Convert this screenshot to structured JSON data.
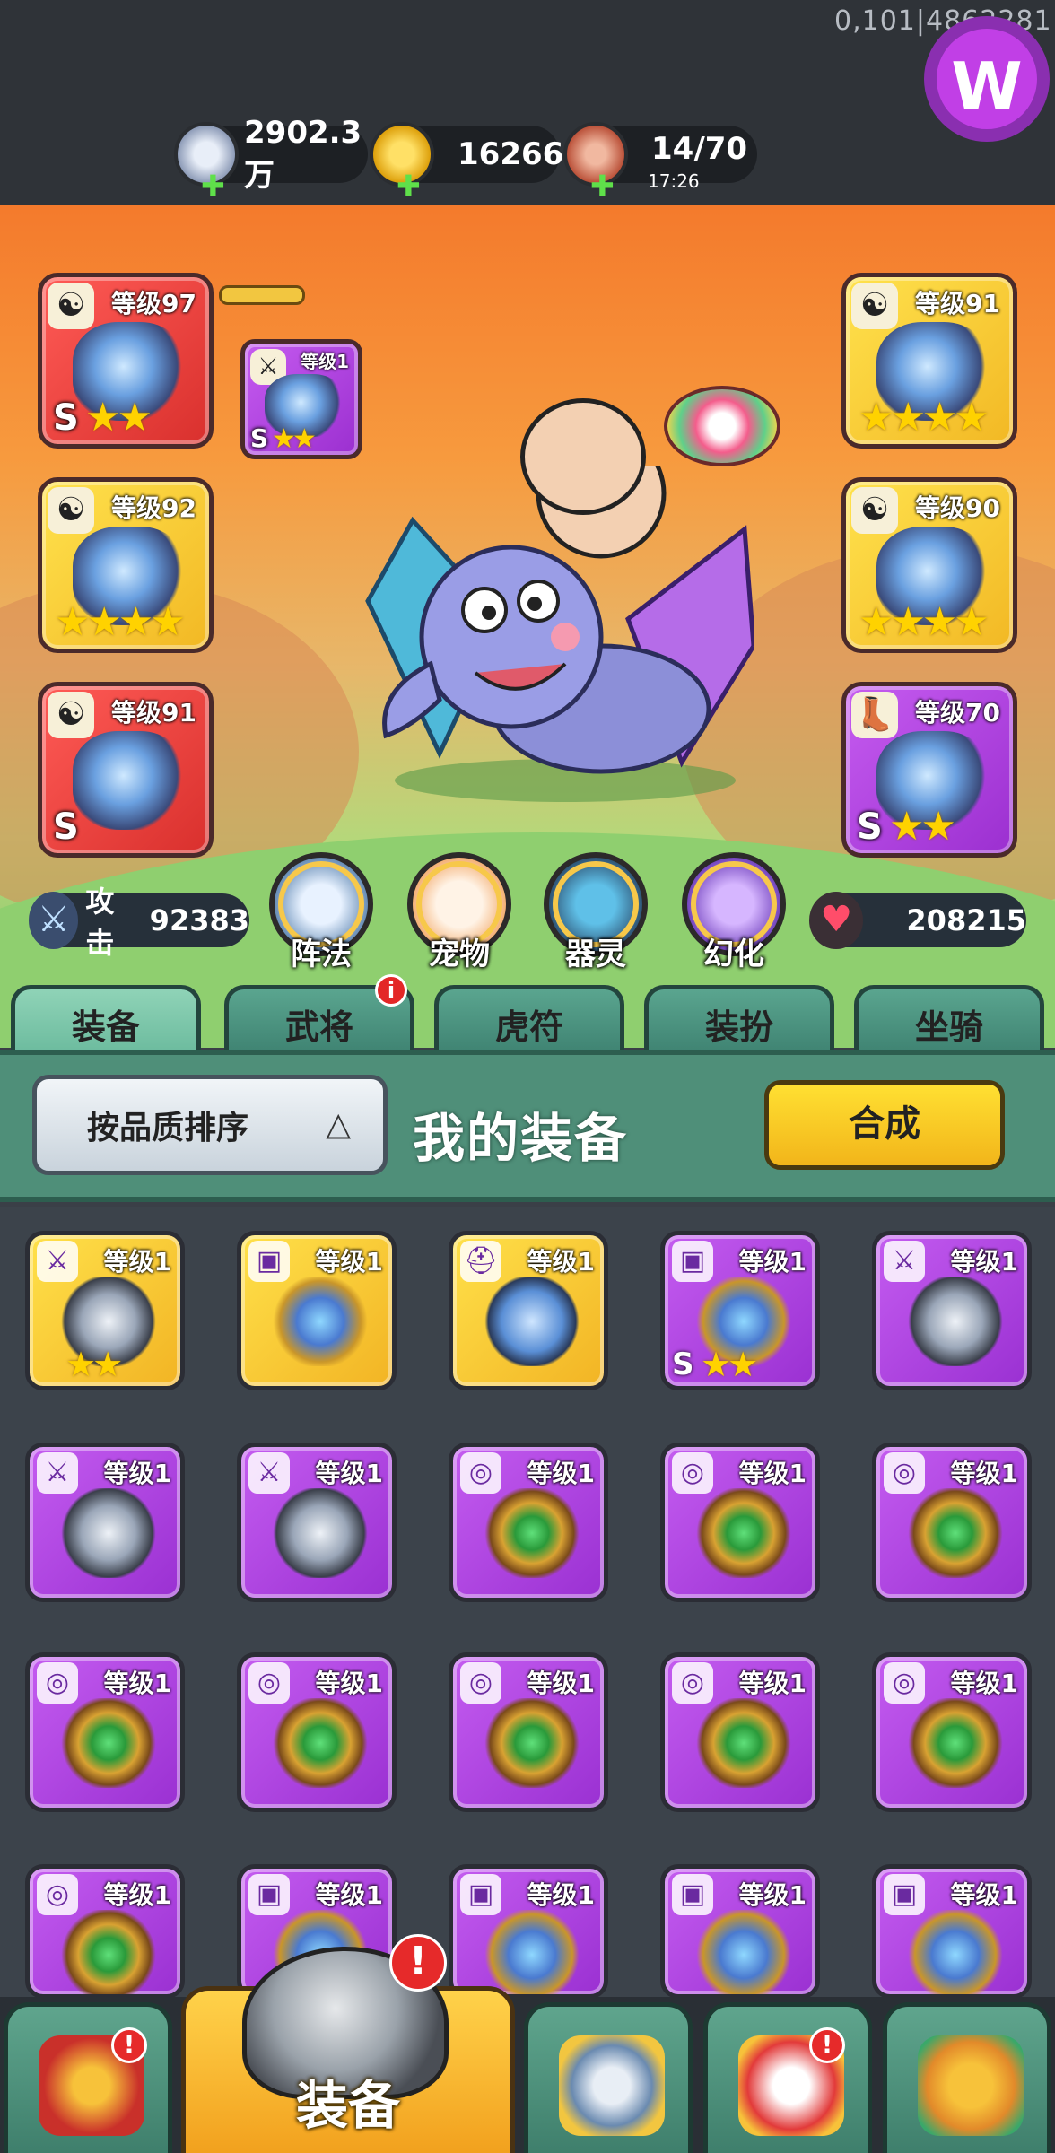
{
  "debug_text": "0,101|4862281",
  "logo": {
    "letter": "W"
  },
  "resources": {
    "coin": {
      "value": "2902.3万",
      "icon": "silver-coin-icon"
    },
    "gold": {
      "value": "16266",
      "icon": "gold-ingot-icon"
    },
    "stamina": {
      "value": "14/70",
      "timer": "17:26",
      "icon": "meat-leg-icon"
    }
  },
  "slots_left": [
    {
      "level": "等级97",
      "rank": "S",
      "stars": "★★",
      "type_icon": "yin-yang-icon"
    },
    {
      "level": "等级92",
      "rank": "",
      "stars": "★★★★",
      "type_icon": "yin-yang-icon"
    },
    {
      "level": "等级91",
      "rank": "S",
      "stars": "",
      "type_icon": "yin-yang-icon"
    }
  ],
  "linked_slot": {
    "level": "等级1",
    "rank": "S",
    "stars": "★★"
  },
  "slots_right": [
    {
      "level": "等级91",
      "rank": "",
      "stars": "★★★★",
      "type_icon": "yin-yang-icon"
    },
    {
      "level": "等级90",
      "rank": "",
      "stars": "★★★★",
      "type_icon": "yin-yang-icon"
    },
    {
      "level": "等级70",
      "rank": "S",
      "stars": "★★",
      "type_icon": "boot-icon"
    }
  ],
  "stats": {
    "attack": {
      "label": "攻击",
      "value": "92383"
    },
    "hp": {
      "value": "208215"
    }
  },
  "feature_buttons": [
    "阵法",
    "宠物",
    "器灵",
    "幻化"
  ],
  "tabs": [
    "装备",
    "武将",
    "虎符",
    "装扮",
    "坐骑"
  ],
  "tab_badge": "i",
  "panel": {
    "sort_label": "按品质排序",
    "title": "我的装备",
    "combine_label": "合成"
  },
  "items": [
    {
      "level": "等级1",
      "color": "gold",
      "type": "sword",
      "stars": "★★",
      "rank": ""
    },
    {
      "level": "等级1",
      "color": "gold",
      "type": "armor",
      "stars": "",
      "rank": ""
    },
    {
      "level": "等级1",
      "color": "gold",
      "type": "helmet",
      "stars": "",
      "rank": ""
    },
    {
      "level": "等级1",
      "color": "purple",
      "type": "armor",
      "stars": "★★",
      "rank": "S"
    },
    {
      "level": "等级1",
      "color": "purple",
      "type": "sword",
      "stars": "",
      "rank": ""
    },
    {
      "level": "等级1",
      "color": "purple",
      "type": "sword",
      "stars": "",
      "rank": ""
    },
    {
      "level": "等级1",
      "color": "purple",
      "type": "sword",
      "stars": "",
      "rank": ""
    },
    {
      "level": "等级1",
      "color": "purple",
      "type": "necklace",
      "stars": "",
      "rank": ""
    },
    {
      "level": "等级1",
      "color": "purple",
      "type": "necklace",
      "stars": "",
      "rank": ""
    },
    {
      "level": "等级1",
      "color": "purple",
      "type": "necklace",
      "stars": "",
      "rank": ""
    },
    {
      "level": "等级1",
      "color": "purple",
      "type": "necklace",
      "stars": "",
      "rank": ""
    },
    {
      "level": "等级1",
      "color": "purple",
      "type": "necklace",
      "stars": "",
      "rank": ""
    },
    {
      "level": "等级1",
      "color": "purple",
      "type": "necklace",
      "stars": "",
      "rank": ""
    },
    {
      "level": "等级1",
      "color": "purple",
      "type": "necklace",
      "stars": "",
      "rank": ""
    },
    {
      "level": "等级1",
      "color": "purple",
      "type": "necklace",
      "stars": "",
      "rank": ""
    },
    {
      "level": "等级1",
      "color": "purple",
      "type": "necklace",
      "stars": "",
      "rank": ""
    },
    {
      "level": "等级1",
      "color": "purple",
      "type": "armor",
      "stars": "",
      "rank": ""
    },
    {
      "level": "等级1",
      "color": "purple",
      "type": "armor",
      "stars": "",
      "rank": ""
    },
    {
      "level": "等级1",
      "color": "purple",
      "type": "armor",
      "stars": "",
      "rank": ""
    },
    {
      "level": "等级1",
      "color": "purple",
      "type": "armor",
      "stars": "",
      "rank": ""
    }
  ],
  "bottom_nav": {
    "active_label": "装备",
    "items": [
      "shrine-icon",
      "equip-helmet-icon",
      "sword-shield-icon",
      "helmet-hero-icon",
      "fist-upgrade-icon"
    ],
    "badge": "!"
  }
}
